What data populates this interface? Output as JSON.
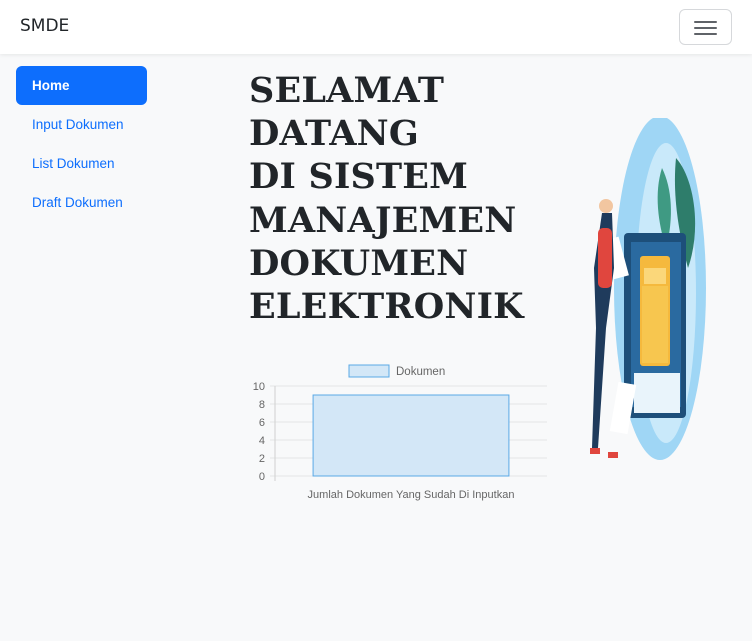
{
  "navbar": {
    "brand": "SMDE",
    "toggler_icon": "hamburger-menu-icon"
  },
  "sidebar": {
    "items": [
      {
        "label": "Home",
        "active": true
      },
      {
        "label": "Input Dokumen",
        "active": false
      },
      {
        "label": "List Dokumen",
        "active": false
      },
      {
        "label": "Draft Dokumen",
        "active": false
      }
    ]
  },
  "main": {
    "headline_lines": [
      "SELAMAT",
      "DATANG",
      "DI SISTEM",
      "MANAJEMEN",
      "DOKUMEN",
      "ELEKTRONIK"
    ],
    "illustration_icon": "document-management-illustration"
  },
  "colors": {
    "primary": "#0d6efd",
    "bar_fill": "#d3e7f7",
    "bar_stroke": "#5aa9e6"
  },
  "chart_data": {
    "type": "bar",
    "categories": [
      "Jumlah Dokumen Yang Sudah Di Inputkan"
    ],
    "series": [
      {
        "name": "Dokumen",
        "values": [
          9
        ]
      }
    ],
    "y_ticks": [
      0,
      2,
      4,
      6,
      8,
      10
    ],
    "ylim": [
      0,
      10
    ],
    "legend_position": "top",
    "grid": true
  }
}
